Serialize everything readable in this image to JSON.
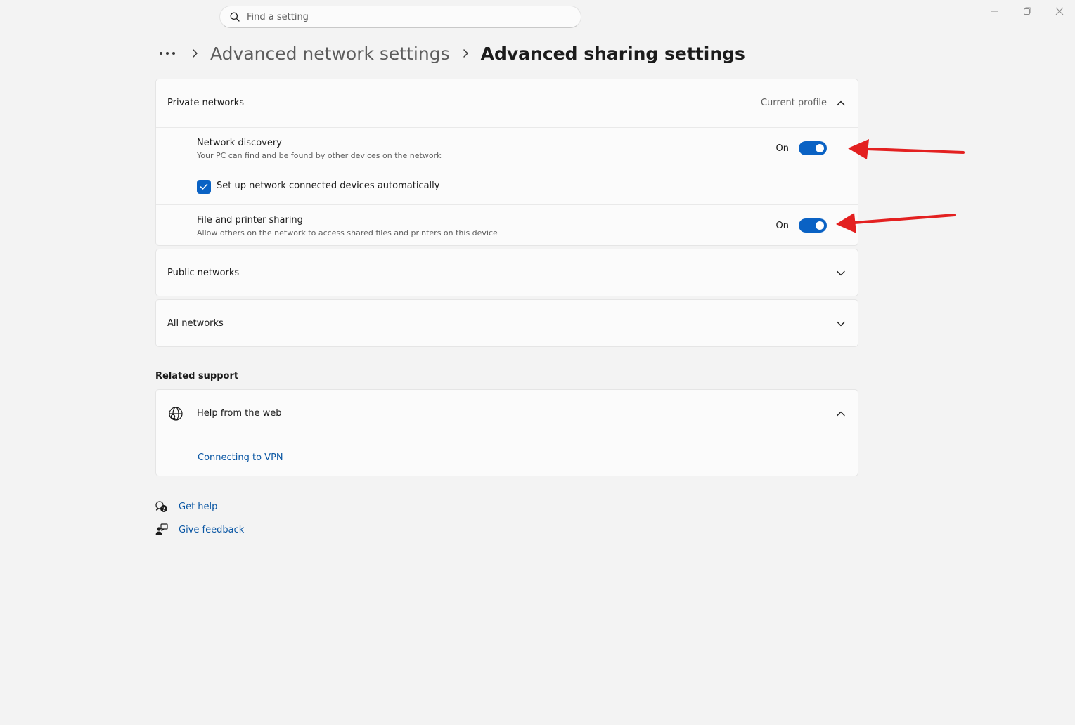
{
  "search": {
    "placeholder": "Find a setting"
  },
  "window_controls": [
    "minimize-icon",
    "restore-icon",
    "close-icon"
  ],
  "breadcrumb": {
    "dots": "•••",
    "items": [
      "Advanced network settings",
      "Advanced sharing settings"
    ]
  },
  "private_networks": {
    "title": "Private networks",
    "status": "Current profile",
    "network_discovery": {
      "title": "Network discovery",
      "description": "Your PC can find and be found by other devices on the network",
      "state": "On"
    },
    "auto_setup": {
      "label": "Set up network connected devices automatically",
      "checked": true
    },
    "file_printer_sharing": {
      "title": "File and printer sharing",
      "description": "Allow others on the network to access shared files and printers on this device",
      "state": "On"
    }
  },
  "public_networks": {
    "title": "Public networks"
  },
  "all_networks": {
    "title": "All networks"
  },
  "related_support": {
    "heading": "Related support",
    "help_from_web": "Help from the web",
    "links": [
      "Connecting to VPN"
    ]
  },
  "footer": {
    "get_help": "Get help",
    "give_feedback": "Give feedback"
  },
  "colors": {
    "accent": "#0a62c4",
    "link": "#0b57a4",
    "annotation_arrow": "#e32020",
    "background": "#f3f3f3"
  }
}
